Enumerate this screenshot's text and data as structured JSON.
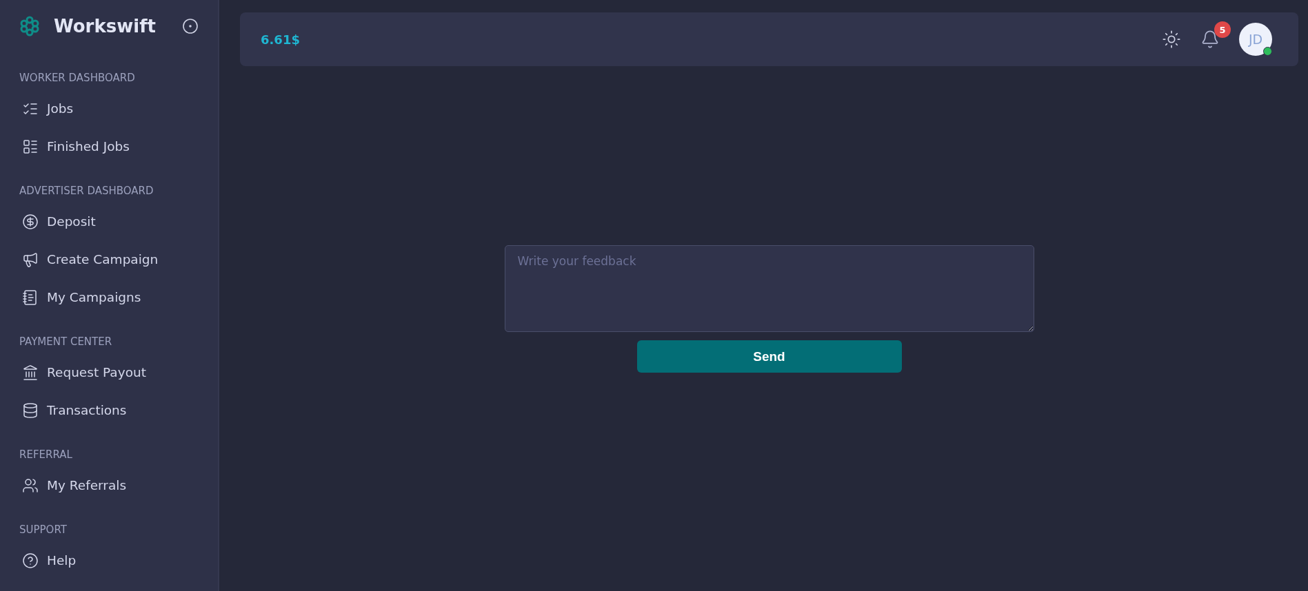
{
  "sidebar": {
    "brand": "Workswift",
    "sections": [
      {
        "title": "WORKER DASHBOARD",
        "items": [
          {
            "label": "Jobs"
          },
          {
            "label": "Finished Jobs"
          }
        ]
      },
      {
        "title": "ADVERTISER DASHBOARD",
        "items": [
          {
            "label": "Deposit"
          },
          {
            "label": "Create Campaign"
          },
          {
            "label": "My Campaigns"
          }
        ]
      },
      {
        "title": "PAYMENT CENTER",
        "items": [
          {
            "label": "Request Payout"
          },
          {
            "label": "Transactions"
          }
        ]
      },
      {
        "title": "REFERRAL",
        "items": [
          {
            "label": "My Referrals"
          }
        ]
      },
      {
        "title": "SUPPORT",
        "items": [
          {
            "label": "Help"
          }
        ]
      }
    ]
  },
  "header": {
    "balance": "6.61$",
    "notifications": "5",
    "avatar": {
      "initials": "JD",
      "online": true
    }
  },
  "feedback": {
    "placeholder": "Write your feedback",
    "button": "Send"
  }
}
